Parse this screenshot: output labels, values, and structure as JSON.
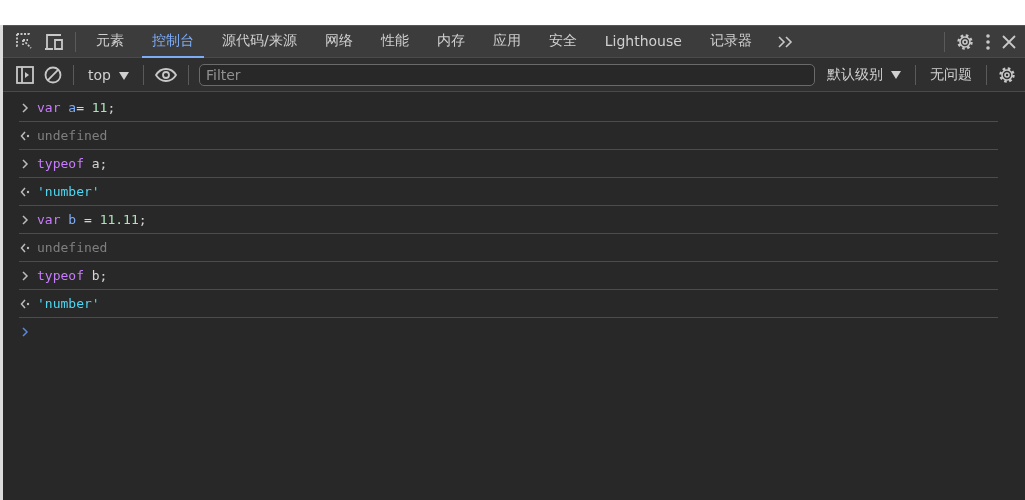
{
  "tabs": [
    {
      "label": "元素",
      "selected": false
    },
    {
      "label": "控制台",
      "selected": true
    },
    {
      "label": "源代码/来源",
      "selected": false
    },
    {
      "label": "网络",
      "selected": false
    },
    {
      "label": "性能",
      "selected": false
    },
    {
      "label": "内存",
      "selected": false
    },
    {
      "label": "应用",
      "selected": false
    },
    {
      "label": "安全",
      "selected": false
    },
    {
      "label": "Lighthouse",
      "selected": false
    },
    {
      "label": "记录器",
      "selected": false
    }
  ],
  "toolbar": {
    "context": "top",
    "filter": {
      "placeholder": "Filter"
    },
    "levels": "默认级别",
    "issues": "无问题"
  },
  "console": [
    {
      "kind": "input",
      "tokens": [
        {
          "kind": "keyword",
          "text": "var"
        },
        {
          "kind": "variable",
          "text": " a"
        },
        {
          "kind": "plain",
          "text": "= "
        },
        {
          "kind": "number",
          "text": "11"
        },
        {
          "kind": "plain",
          "text": ";"
        }
      ]
    },
    {
      "kind": "output",
      "tokens": [
        {
          "kind": "undefined",
          "text": "undefined"
        }
      ]
    },
    {
      "kind": "input",
      "tokens": [
        {
          "kind": "keyword",
          "text": "typeof"
        },
        {
          "kind": "plain",
          "text": " a;"
        }
      ]
    },
    {
      "kind": "output",
      "tokens": [
        {
          "kind": "string",
          "text": "'number'"
        }
      ]
    },
    {
      "kind": "input",
      "tokens": [
        {
          "kind": "keyword",
          "text": "var"
        },
        {
          "kind": "variable",
          "text": " b"
        },
        {
          "kind": "plain",
          "text": " = "
        },
        {
          "kind": "number",
          "text": "11.11"
        },
        {
          "kind": "plain",
          "text": ";"
        }
      ]
    },
    {
      "kind": "output",
      "tokens": [
        {
          "kind": "undefined",
          "text": "undefined"
        }
      ]
    },
    {
      "kind": "input",
      "tokens": [
        {
          "kind": "keyword",
          "text": "typeof"
        },
        {
          "kind": "plain",
          "text": " b;"
        }
      ]
    },
    {
      "kind": "output",
      "tokens": [
        {
          "kind": "string",
          "text": "'number'"
        }
      ]
    }
  ]
}
